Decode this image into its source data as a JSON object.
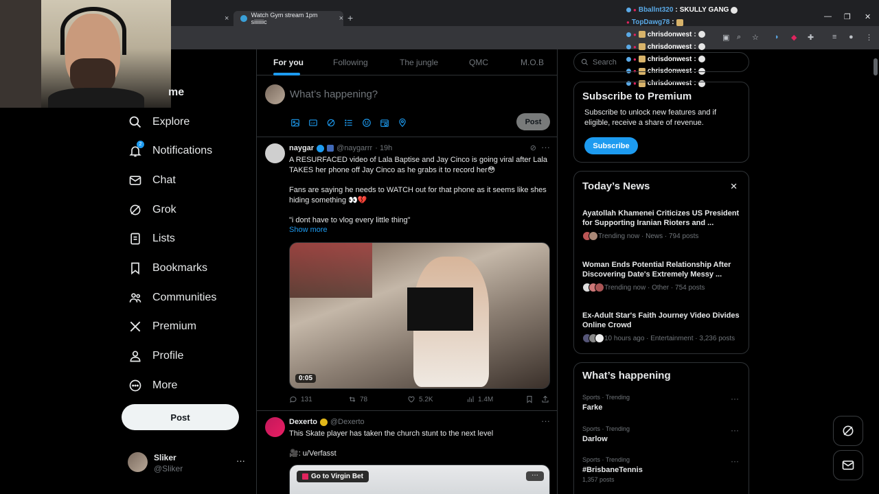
{
  "browser": {
    "tab_active_title": "Watch Gym stream 1pm siiiiiiic",
    "tab_inactive_close": "×",
    "new_tab": "+"
  },
  "chat": [
    {
      "user": "Bballnt320",
      "message": "SKULLY GANG"
    },
    {
      "user": "TopDawg78",
      "message": ""
    },
    {
      "user": "chrisdonwest",
      "message": ""
    },
    {
      "user": "chrisdonwest",
      "message": ""
    },
    {
      "user": "chrisdonwest",
      "message": ""
    },
    {
      "user": "chrisdonwest",
      "message": ""
    },
    {
      "user": "chrisdonwest",
      "message": ""
    },
    {
      "user": "TopDawg78",
      "message": ""
    }
  ],
  "nav": {
    "items": [
      {
        "label": "me",
        "icon": "home-icon"
      },
      {
        "label": "Explore",
        "icon": "search-icon"
      },
      {
        "label": "Notifications",
        "icon": "bell-icon",
        "badge": "2"
      },
      {
        "label": "Chat",
        "icon": "mail-icon"
      },
      {
        "label": "Grok",
        "icon": "grok-icon"
      },
      {
        "label": "Lists",
        "icon": "list-icon"
      },
      {
        "label": "Bookmarks",
        "icon": "bookmark-icon"
      },
      {
        "label": "Communities",
        "icon": "people-icon"
      },
      {
        "label": "Premium",
        "icon": "x-logo-icon"
      },
      {
        "label": "Profile",
        "icon": "person-icon"
      },
      {
        "label": "More",
        "icon": "more-circle-icon"
      }
    ],
    "post_button": "Post"
  },
  "account": {
    "name": "Sliker",
    "handle": "@Sliker",
    "menu": "···"
  },
  "timeline": {
    "tabs": [
      "For you",
      "Following",
      "The jungle",
      "QMC",
      "M.O.B"
    ],
    "selected_tab": "For you",
    "compose_placeholder": "What’s happening?",
    "compose_post": "Post"
  },
  "tweets": [
    {
      "name": "naygar",
      "handle": "@naygarrr",
      "time": "· 19h",
      "text1": "A RESURFACED video of Lala Baptise and Jay Cinco is going viral after Lala TAKES her phone off Jay Cinco as he grabs it to record her😳",
      "text2": "Fans are saying he needs to WATCH out for that phone as it seems like shes hiding something 👀💔",
      "text3": "\"i dont have to vlog every little thing\"",
      "show_more": "Show more",
      "video_time": "0:05",
      "replies": "131",
      "reposts": "78",
      "likes": "5.2K",
      "views": "1.4M"
    },
    {
      "name": "Dexerto",
      "handle": "@Dexerto",
      "text1": "This Skate player has taken the church stunt to the next level",
      "text2": "🎥: u/Verfasst",
      "ad_label": "Go to Virgin Bet"
    }
  ],
  "sidebar": {
    "search_placeholder": "Search",
    "premium_title": "Subscribe to Premium",
    "premium_text": "Subscribe to unlock new features and if eligible, receive a share of revenue.",
    "premium_button": "Subscribe",
    "news_title": "Today’s News",
    "news": [
      {
        "title": "Ayatollah Khamenei Criticizes US President for Supporting Iranian Rioters and ...",
        "meta": "Trending now · News · 794 posts"
      },
      {
        "title": "Woman Ends Potential Relationship After Discovering Date's Extremely Messy ...",
        "meta": "Trending now · Other · 754 posts"
      },
      {
        "title": "Ex-Adult Star's Faith Journey Video Divides Online Crowd",
        "meta": "10 hours ago · Entertainment · 3,236 posts"
      }
    ],
    "happening_title": "What’s happening",
    "trends": [
      {
        "category": "Sports · Trending",
        "name": "Farke",
        "posts": ""
      },
      {
        "category": "Sports · Trending",
        "name": "Darlow",
        "posts": ""
      },
      {
        "category": "Sports · Trending",
        "name": "#BrisbaneTennis",
        "posts": "1,357 posts"
      }
    ]
  },
  "colors": {
    "accent": "#1d9bf0",
    "background": "#000000",
    "border": "#2f3336",
    "muted": "#71767b"
  }
}
